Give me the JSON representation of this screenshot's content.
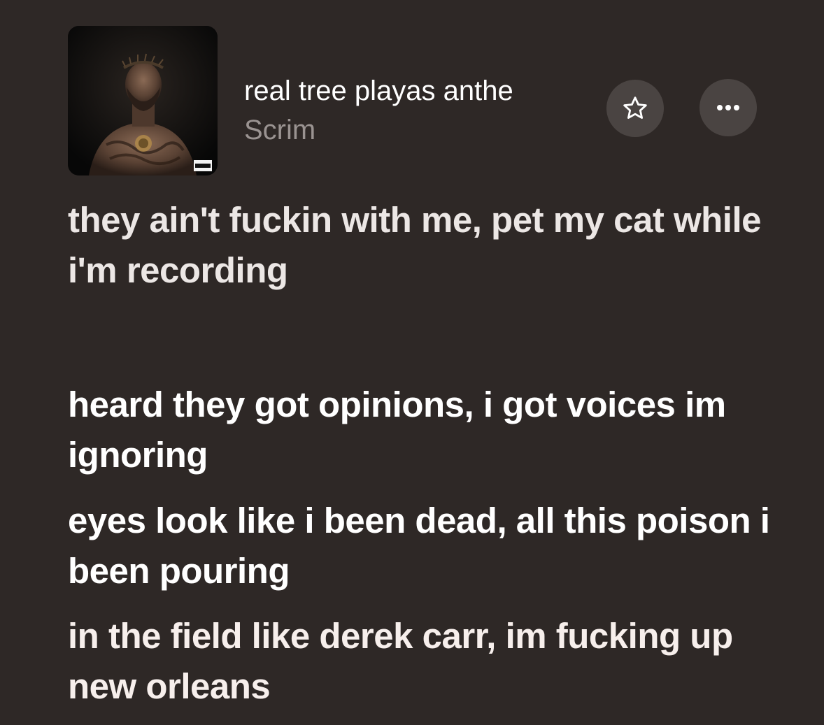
{
  "now_playing": {
    "title": "real tree playas anthe",
    "artist": "Scrim",
    "artwork": "album-artwork",
    "explicit_label": "PARENTAL ADVISORY EXPLICIT CONTENT"
  },
  "actions": {
    "favorite_icon": "star-outline-icon",
    "more_icon": "ellipsis-icon"
  },
  "lyrics": [
    "they ain't fuckin with me, pet my cat while i'm recording",
    "heard they got opinions, i got voices im ignoring",
    "eyes look like i been dead, all this poison i been pouring",
    "in the field like derek carr, im fucking up new orleans"
  ],
  "colors": {
    "background": "#2e2826",
    "button_bg": "#4a4442",
    "primary_text": "#ffffff",
    "secondary_text": "#9a9391"
  }
}
